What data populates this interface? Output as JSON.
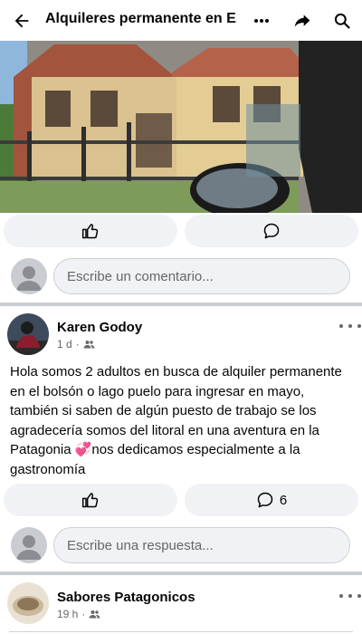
{
  "header": {
    "title": "Alquileres permanente en E...",
    "icons": [
      "back-arrow-icon",
      "more-icon",
      "share-icon",
      "search-icon"
    ]
  },
  "post1": {
    "image_alt": "house-photo",
    "comment_placeholder": "Escribe un comentario..."
  },
  "comment": {
    "author": "Karen Godoy",
    "time": "1 d",
    "text": "Hola somos 2 adultos en busca de alquiler permanente en el bolsón o lago puelo para ingresar en mayo, también si saben de algún puesto de trabajo se los agradecería somos del litoral en una aventura en la Patagonia 💞nos dedicamos especialmente a la gastronomía",
    "comment_count": "6",
    "reply_placeholder": "Escribe una respuesta..."
  },
  "next_post": {
    "author": "Sabores Patagonicos",
    "time": "19 h"
  },
  "colors": {
    "pill_bg": "#f0f2f5",
    "secondary_text": "#65676b",
    "divider": "#c9ccd1"
  }
}
